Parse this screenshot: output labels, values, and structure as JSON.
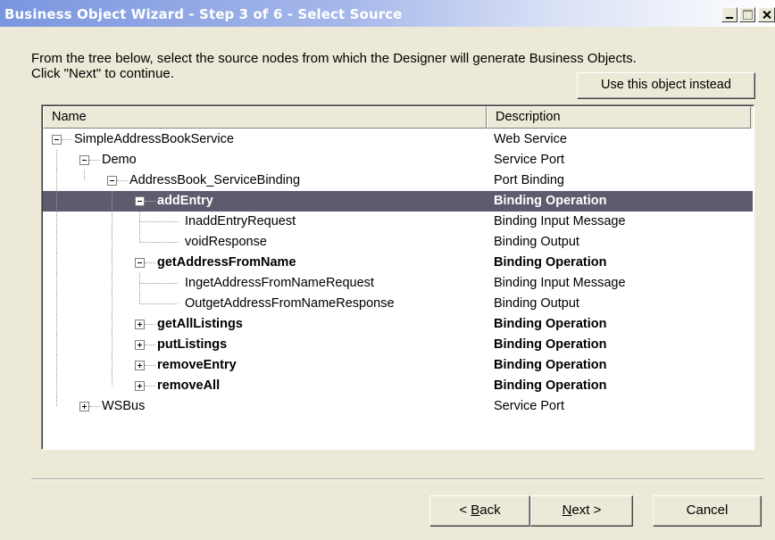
{
  "window": {
    "title": "Business Object Wizard - Step 3 of 6 - Select Source",
    "minimize_icon": "minimize-icon",
    "maximize_icon": "maximize-icon",
    "close_icon": "close-icon"
  },
  "instructions": {
    "line1": "From the tree below, select the source nodes from which the Designer will generate Business Objects.",
    "line2": "Click \"Next\" to continue."
  },
  "use_object_button": "Use this object instead",
  "tree": {
    "columns": {
      "name": "Name",
      "description": "Description"
    },
    "rows": [
      {
        "name": "SimpleAddressBookService",
        "description": "Web Service",
        "depth": 0,
        "toggle": "minus",
        "bold": false,
        "selected": false
      },
      {
        "name": "Demo",
        "description": "Service Port",
        "depth": 1,
        "toggle": "minus",
        "bold": false,
        "selected": false
      },
      {
        "name": "AddressBook_ServiceBinding",
        "description": "Port Binding",
        "depth": 2,
        "toggle": "minus",
        "bold": false,
        "selected": false
      },
      {
        "name": "addEntry",
        "description": "Binding Operation",
        "depth": 3,
        "toggle": "minus",
        "bold": true,
        "selected": true
      },
      {
        "name": "InaddEntryRequest",
        "description": "Binding Input Message",
        "depth": 4,
        "toggle": "none",
        "bold": false,
        "selected": false
      },
      {
        "name": "voidResponse",
        "description": "Binding Output",
        "depth": 4,
        "toggle": "none",
        "bold": false,
        "selected": false
      },
      {
        "name": "getAddressFromName",
        "description": "Binding Operation",
        "depth": 3,
        "toggle": "minus",
        "bold": true,
        "selected": false
      },
      {
        "name": "IngetAddressFromNameRequest",
        "description": "Binding Input Message",
        "depth": 4,
        "toggle": "none",
        "bold": false,
        "selected": false
      },
      {
        "name": "OutgetAddressFromNameResponse",
        "description": "Binding Output",
        "depth": 4,
        "toggle": "none",
        "bold": false,
        "selected": false
      },
      {
        "name": "getAllListings",
        "description": "Binding Operation",
        "depth": 3,
        "toggle": "plus",
        "bold": true,
        "selected": false
      },
      {
        "name": "putListings",
        "description": "Binding Operation",
        "depth": 3,
        "toggle": "plus",
        "bold": true,
        "selected": false
      },
      {
        "name": "removeEntry",
        "description": "Binding Operation",
        "depth": 3,
        "toggle": "plus",
        "bold": true,
        "selected": false
      },
      {
        "name": "removeAll",
        "description": "Binding Operation",
        "depth": 3,
        "toggle": "plus",
        "bold": true,
        "selected": false
      },
      {
        "name": "WSBus",
        "description": "Service Port",
        "depth": 1,
        "toggle": "plus",
        "bold": false,
        "selected": false
      }
    ]
  },
  "buttons": {
    "back_prefix": "< ",
    "back_mnemonic": "B",
    "back_rest": "ack",
    "next_mnemonic": "N",
    "next_rest": "ext >",
    "cancel": "Cancel"
  },
  "colors": {
    "selection": "#5d5c6f",
    "window_bg": "#ece9d8",
    "title_gradient_start": "#7a96df"
  }
}
